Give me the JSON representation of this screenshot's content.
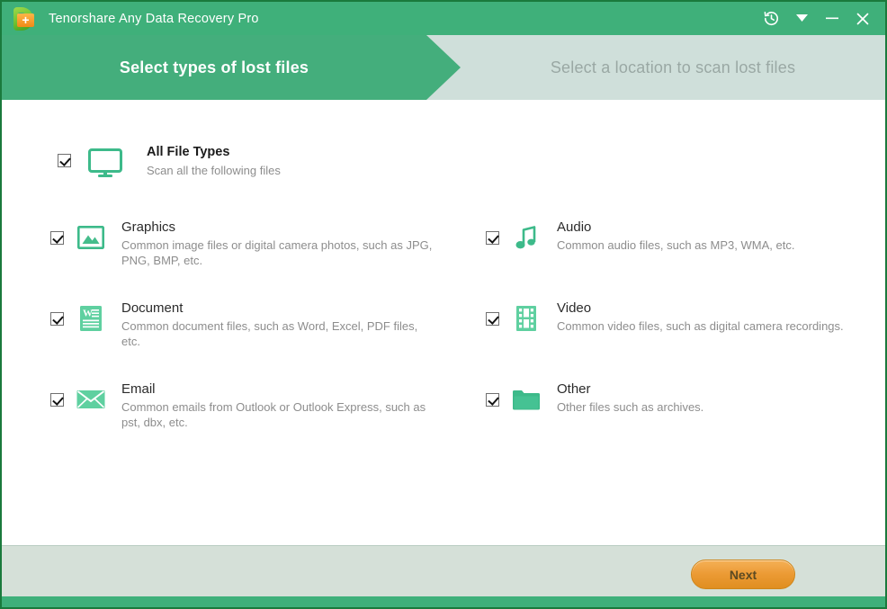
{
  "window": {
    "title": "Tenorshare Any Data Recovery Pro",
    "accent_green": "#3fb07a",
    "tab_active_green": "#44ae7c",
    "tab_inactive_green": "#cfdfda",
    "footer_bg": "#d5e0d8",
    "button_orange": "#eb9a34",
    "border_green": "#1a7a3c"
  },
  "titlebar": {
    "logo_name": "tenorshare-logo",
    "logo_plus": "+",
    "controls": [
      {
        "name": "history-icon",
        "glyph": "history"
      },
      {
        "name": "chevron-down-icon",
        "glyph": "▼"
      },
      {
        "name": "minimize-button",
        "glyph": "–"
      },
      {
        "name": "close-button",
        "glyph": "✕"
      }
    ]
  },
  "steps": [
    {
      "label": "Select types of lost files",
      "state": "active"
    },
    {
      "label": "Select a location to scan lost files",
      "state": "inactive"
    }
  ],
  "all_file_types": {
    "checked": true,
    "icon": "monitor-icon",
    "title": "All File Types",
    "desc": "Scan all the following files"
  },
  "file_types": [
    {
      "icon": "image-icon",
      "title": "Graphics",
      "desc": "Common image files or digital camera photos, such as JPG, PNG, BMP, etc.",
      "checked": true,
      "column": "left"
    },
    {
      "icon": "audio-note-icon",
      "title": "Audio",
      "desc": "Common audio files, such as MP3, WMA, etc.",
      "checked": true,
      "column": "right"
    },
    {
      "icon": "document-icon",
      "title": "Document",
      "desc": "Common document files, such as Word, Excel, PDF files, etc.",
      "checked": true,
      "column": "left"
    },
    {
      "icon": "film-icon",
      "title": "Video",
      "desc": "Common video files, such as digital camera recordings.",
      "checked": true,
      "column": "right"
    },
    {
      "icon": "envelope-icon",
      "title": "Email",
      "desc": "Common emails from Outlook or Outlook Express, such as pst, dbx, etc.",
      "checked": true,
      "column": "left"
    },
    {
      "icon": "folder-icon",
      "title": "Other",
      "desc": "Other files such as archives.",
      "checked": true,
      "column": "right"
    }
  ],
  "footer": {
    "next_label": "Next"
  }
}
